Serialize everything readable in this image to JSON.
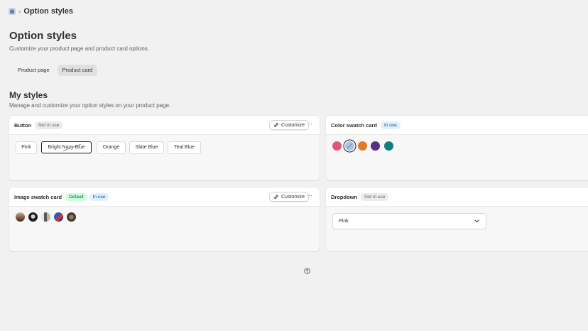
{
  "breadcrumb": {
    "separator": "›",
    "current": "Option styles"
  },
  "header": {
    "title": "Option styles",
    "subtitle": "Customize your product page and product card options."
  },
  "tabs": [
    {
      "label": "Product page",
      "active": false
    },
    {
      "label": "Product card",
      "active": true
    }
  ],
  "section": {
    "title": "My styles",
    "subtitle": "Manage and customize your option styles on your product page."
  },
  "cards": {
    "button": {
      "title": "Button",
      "badge": "Not in use",
      "customize_label": "Customize",
      "more_label": "···",
      "options": [
        "Pink",
        "Bright Navy Blue",
        "Orange",
        "Slate Blue",
        "Teal Blue"
      ],
      "selected": "Bright Navy Blue"
    },
    "color_swatch": {
      "title": "Color swatch card",
      "badge": "In use",
      "colors": [
        "#e0557a",
        "#a9c3e6",
        "#e07a2a",
        "#5b2d86",
        "#0f7f7f"
      ]
    },
    "image_swatch": {
      "title": "Image swatch card",
      "badge_default": "Default",
      "badge": "In use",
      "customize_label": "Customize",
      "more_label": "···"
    },
    "dropdown": {
      "title": "Dropdown",
      "badge": "Not in use",
      "value": "Pink"
    }
  },
  "colors": {
    "background": "#f1f1f1",
    "card": "#f7f7f7",
    "selected_border": "#1a1a1a"
  }
}
